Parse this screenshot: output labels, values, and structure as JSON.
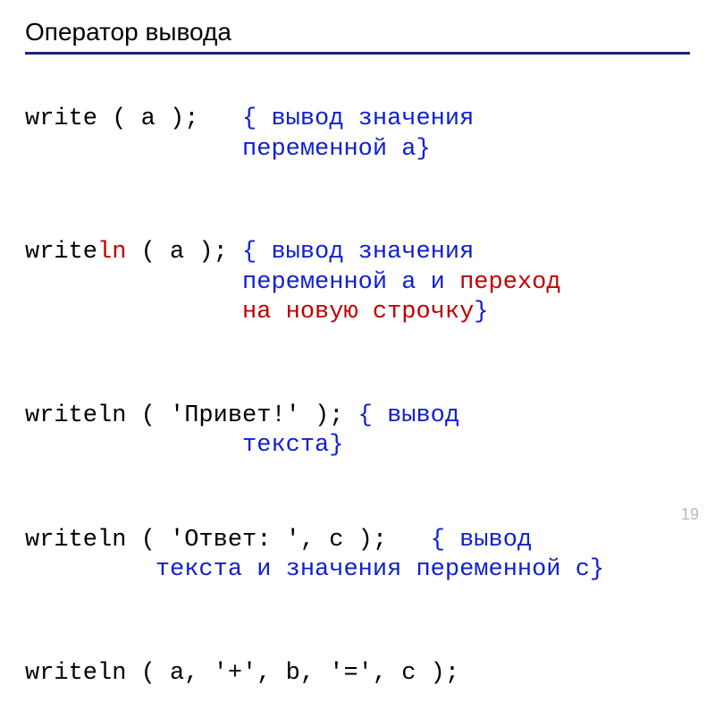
{
  "title": "Оператор вывода",
  "page_number": "19",
  "line1": {
    "code": "write ( a );   ",
    "c_open": "{ ",
    "c1": "вывод значения",
    "c_indent": "               ",
    "c2": "переменной a",
    "c_close": "}"
  },
  "line2": {
    "code_a": "write",
    "code_ln": "ln",
    "code_b": " ( a ); ",
    "c_open": "{ ",
    "c1": "вывод значения",
    "c_indent": "               ",
    "c2": "переменной a и ",
    "c_red": "переход",
    "c_indent2": "               ",
    "c_red2": "на новую строчку",
    "c_close": "}"
  },
  "line3": {
    "code": "writeln ( 'Привет!' ); ",
    "c_open": "{ ",
    "c1": "вывод",
    "c_indent": "               ",
    "c2": "текста",
    "c_close": "}"
  },
  "line4": {
    "code": "writeln ( 'Ответ: ', c );   ",
    "c_open": "{ ",
    "c1": "вывод",
    "c_indent": "         ",
    "c2": "текста и значения переменной c",
    "c_close": "}"
  },
  "line5": {
    "code": "writeln ( a, '+', b, '=', c );"
  }
}
